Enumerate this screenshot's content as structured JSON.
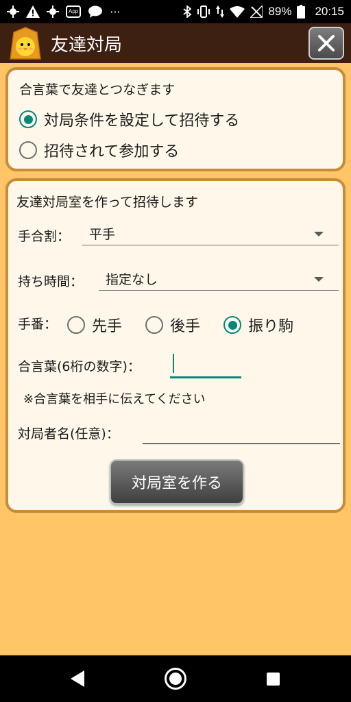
{
  "statusbar": {
    "left_icons": [
      "gear-icon",
      "warning-icon",
      "gear-icon",
      "app-icon",
      "chat-bubble-icon",
      "more-icon"
    ],
    "app_badge": "App",
    "more_dots": "···",
    "battery_percent": "89%",
    "time": "20:15"
  },
  "appbar": {
    "title": "友達対局",
    "close_icon": "close-icon"
  },
  "mode_panel": {
    "heading": "合言葉で友達とつなぎます",
    "options": [
      {
        "label": "対局条件を設定して招待する",
        "selected": true
      },
      {
        "label": "招待されて参加する",
        "selected": false
      }
    ]
  },
  "create_panel": {
    "heading": "友達対局室を作って招待します",
    "handicap": {
      "label": "手合割：",
      "value": "平手"
    },
    "time_control": {
      "label": "持ち時間：",
      "value": "指定なし"
    },
    "turn": {
      "label": "手番：",
      "options": [
        {
          "label": "先手",
          "selected": false
        },
        {
          "label": "後手",
          "selected": false
        },
        {
          "label": "振り駒",
          "selected": true
        }
      ]
    },
    "password": {
      "label": "合言葉(6桁の数字)：",
      "value": ""
    },
    "note": "※合言葉を相手に伝えてください",
    "player_name": {
      "label": "対局者名(任意)：",
      "value": ""
    },
    "create_button": "対局室を作る"
  },
  "colors": {
    "background": "#ffc567",
    "header": "#3d2012",
    "panel": "#fff8ea",
    "panel_border": "#c98a3a",
    "accent": "#00897b"
  }
}
